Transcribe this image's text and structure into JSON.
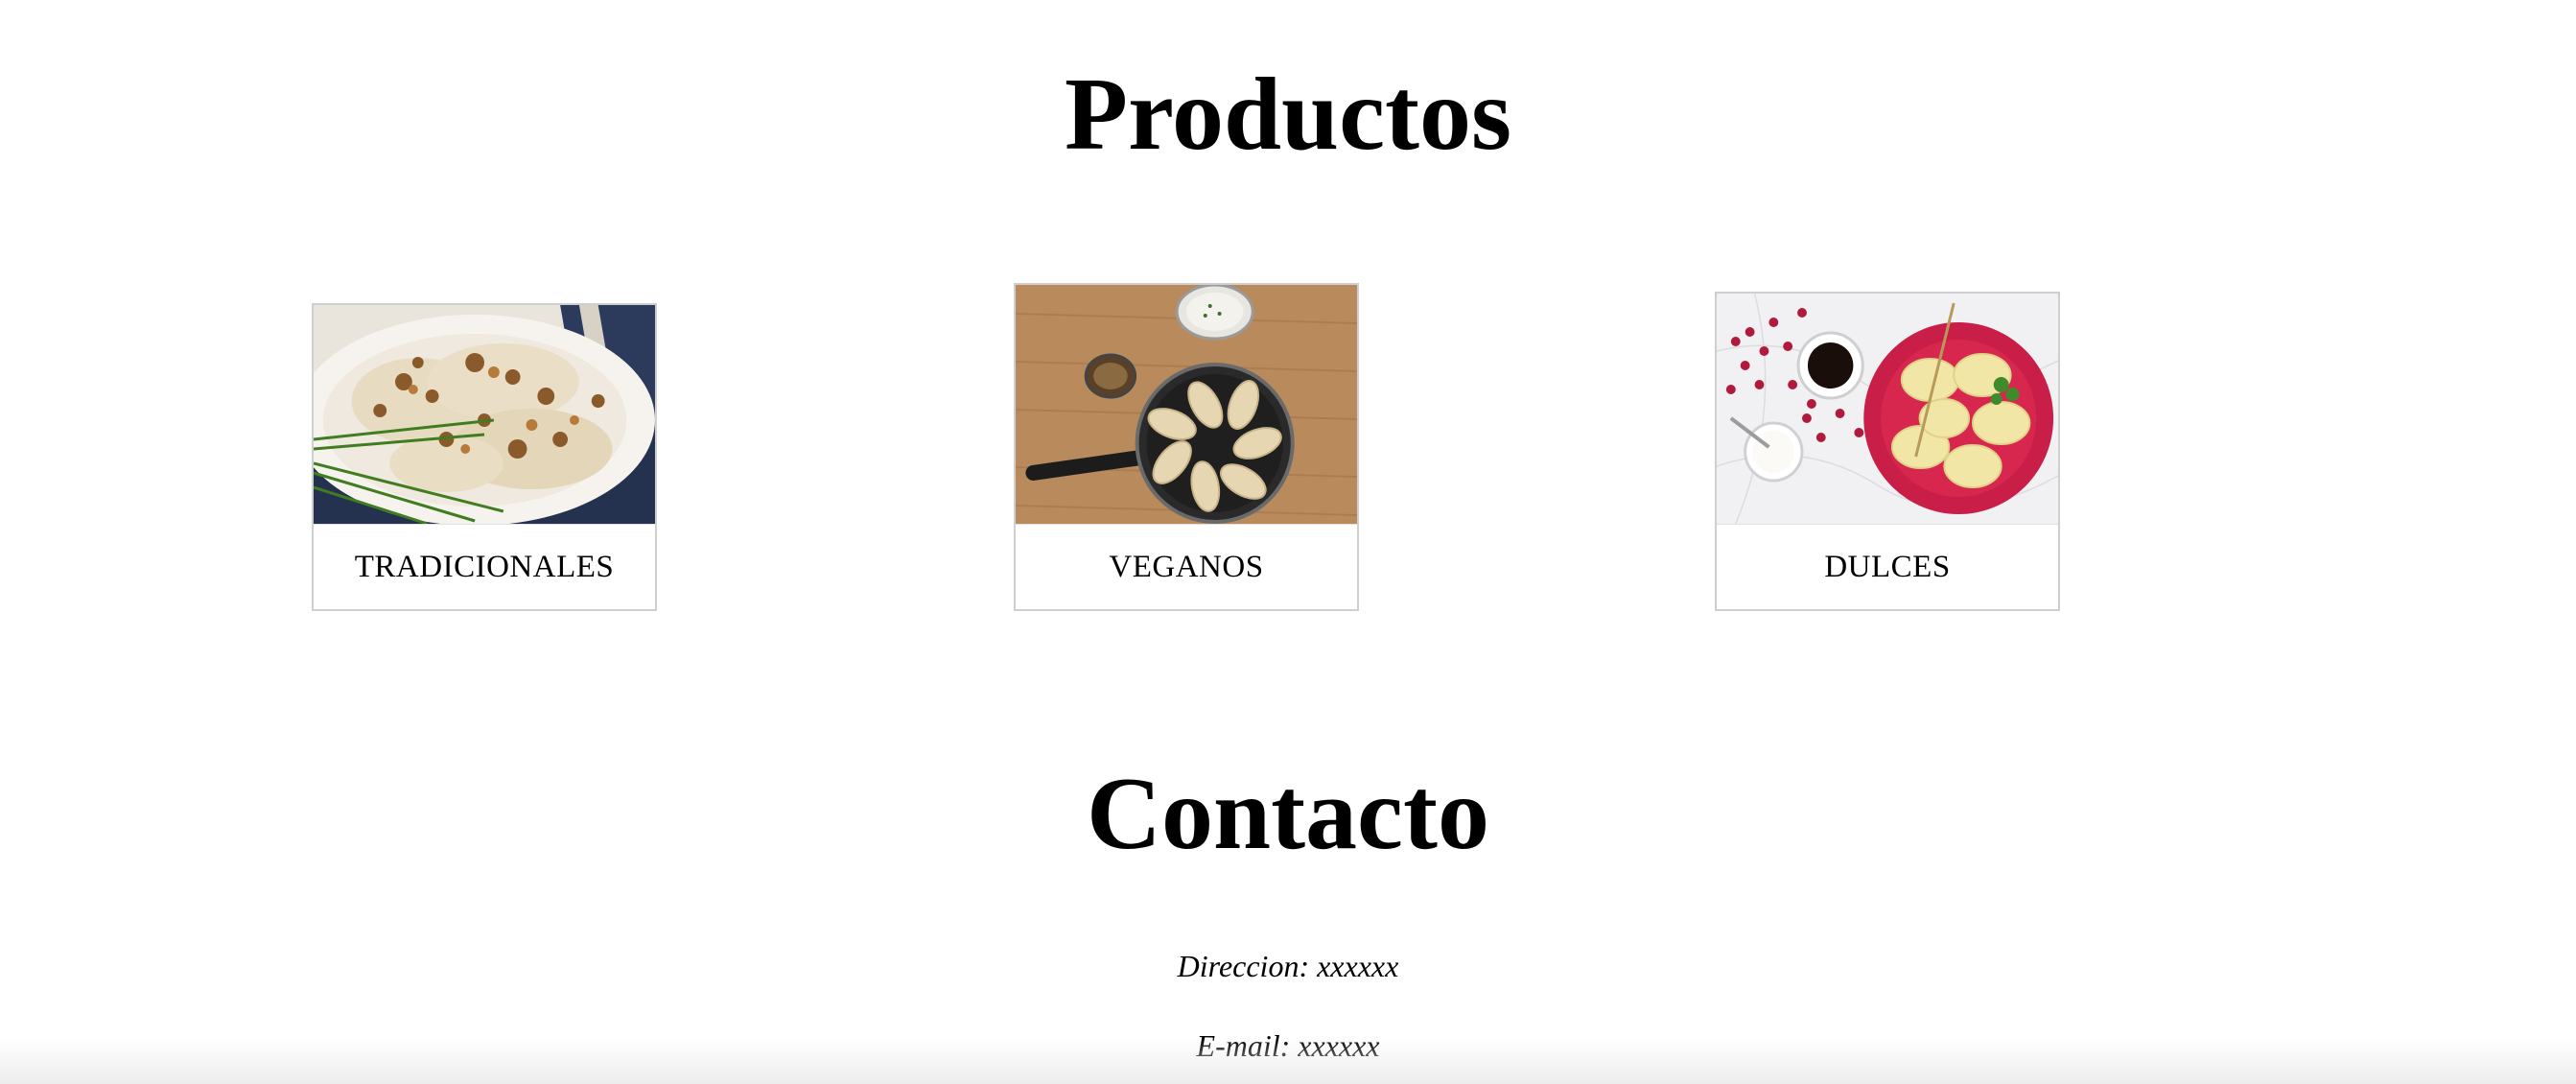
{
  "products": {
    "title": "Productos",
    "items": [
      {
        "label": "TRADICIONALES",
        "image": "pierogi-with-onions-photo"
      },
      {
        "label": "VEGANOS",
        "image": "dumplings-in-pan-photo"
      },
      {
        "label": "DULCES",
        "image": "sweet-dumplings-with-cranberries-photo"
      }
    ]
  },
  "contact": {
    "title": "Contacto",
    "address": "Direccion: xxxxxx",
    "email": "E-mail: xxxxxx"
  },
  "colors": {
    "card_border": "#cfcfcf",
    "background": "#ffffff",
    "text": "#000000"
  }
}
